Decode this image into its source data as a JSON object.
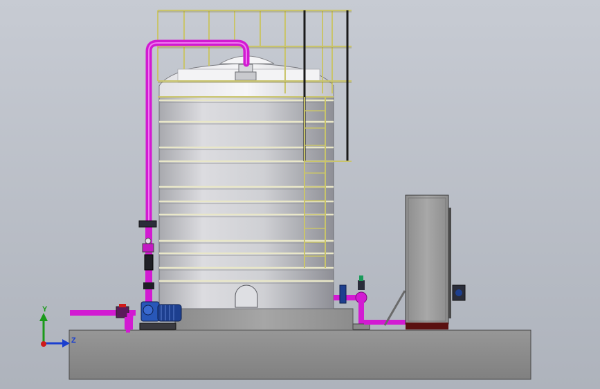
{
  "viewport": {
    "background_top": "#c7cbd3",
    "background_bottom": "#aeb3bc"
  },
  "colors": {
    "tank_body": "#c9c9cd",
    "tank_shadow": "#8f9097",
    "ring_band": "#e8e6c8",
    "railing": "#c9c46b",
    "ladder_black": "#1a1a1a",
    "pipe_magenta": "#d21ad2",
    "pump_blue": "#1d3f8f",
    "base_slab": "#8a8a8a",
    "cabinet": "#9a9a9a",
    "cabinet_foot": "#5a1010"
  },
  "triad": {
    "y_label": "Y",
    "z_label": "Z",
    "y_color": "#1a9a1a",
    "z_color": "#1a3fcf",
    "origin_color": "#cf1a1a"
  },
  "icons": {
    "triad": "coordinate-triad-icon"
  }
}
